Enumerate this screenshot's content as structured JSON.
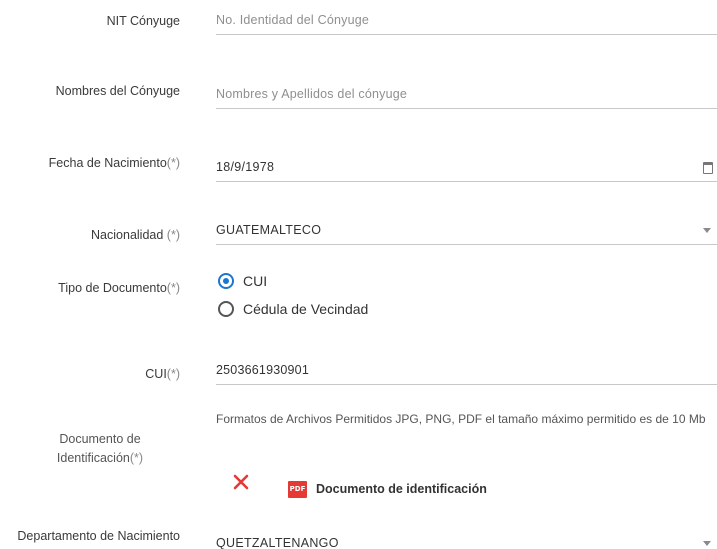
{
  "fields": {
    "nit_conyuge": {
      "label": "NIT Cónyuge",
      "placeholder": "No. Identidad del Cónyuge",
      "value": ""
    },
    "nombres_conyuge": {
      "label": "Nombres del Cónyuge",
      "placeholder": "Nombres y Apellidos del cónyuge",
      "value": ""
    },
    "fecha_nacimiento": {
      "label": "Fecha de Nacimiento",
      "required_mark": "(*)",
      "value": "18/9/1978"
    },
    "nacionalidad": {
      "label": "Nacionalidad",
      "required_mark": "(*)",
      "value": "GUATEMALTECO"
    },
    "tipo_documento": {
      "label": "Tipo de Documento",
      "required_mark": "(*)",
      "options": [
        {
          "label": "CUI",
          "checked": true
        },
        {
          "label": "Cédula de Vecindad",
          "checked": false
        }
      ]
    },
    "cui": {
      "label": "CUI",
      "required_mark": "(*)",
      "value": "2503661930901"
    },
    "documento_identificacion": {
      "label_line1": "Documento de",
      "label_line2": "Identificación",
      "required_mark": "(*)",
      "info": "Formatos de Archivos Permitidos JPG, PNG, PDF el tamaño máximo permitido es de 10 Mb",
      "file_badge": "PDF",
      "file_name": "Documento de identificación",
      "remove_icon": "close-icon"
    },
    "departamento_nacimiento": {
      "label": "Departamento de Nacimiento",
      "value": "QUETZALTENANGO"
    }
  },
  "colors": {
    "radio_selected": "#1976d2",
    "remove_icon": "#e53935",
    "pdf_badge": "#e53935",
    "field_border": "#c8c8c8"
  }
}
